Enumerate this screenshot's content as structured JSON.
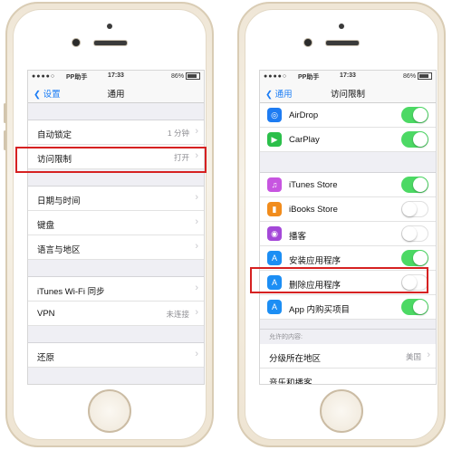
{
  "colors": {
    "accent": "#1a7cf5",
    "toggle_on": "#4cd964",
    "highlight": "#d62121"
  },
  "left": {
    "status": {
      "carrier": "PP助手",
      "time": "17:33",
      "battery": "86%"
    },
    "nav": {
      "back": "设置",
      "title": "通用"
    },
    "rows": [
      {
        "label": "自动锁定",
        "value": "1 分钟"
      },
      {
        "label": "访问限制",
        "value": "打开"
      },
      {
        "label": "日期与时间",
        "value": ""
      },
      {
        "label": "键盘",
        "value": ""
      },
      {
        "label": "语言与地区",
        "value": ""
      },
      {
        "label": "iTunes Wi-Fi 同步",
        "value": ""
      },
      {
        "label": "VPN",
        "value": "未连接"
      },
      {
        "label": "还原",
        "value": ""
      }
    ]
  },
  "right": {
    "status": {
      "carrier": "PP助手",
      "time": "17:33",
      "battery": "86%"
    },
    "nav": {
      "back": "通用",
      "title": "访问限制"
    },
    "rows": [
      {
        "label": "AirDrop",
        "icon": "airdrop-icon",
        "on": true
      },
      {
        "label": "CarPlay",
        "icon": "carplay-icon",
        "on": true
      },
      {
        "label": "iTunes Store",
        "icon": "itunes-store-icon",
        "on": true
      },
      {
        "label": "iBooks Store",
        "icon": "ibooks-store-icon",
        "on": false
      },
      {
        "label": "播客",
        "icon": "podcasts-icon",
        "on": false
      },
      {
        "label": "安装应用程序",
        "icon": "app-store-icon",
        "on": true
      },
      {
        "label": "删除应用程序",
        "icon": "app-store-icon",
        "on": false
      },
      {
        "label": "App 内购买项目",
        "icon": "app-store-icon",
        "on": true
      }
    ],
    "section_header": "允许的内容:",
    "rating_row": {
      "label": "分级所在地区",
      "value": "美国"
    },
    "partial_row": {
      "label": "音乐和播客"
    }
  }
}
